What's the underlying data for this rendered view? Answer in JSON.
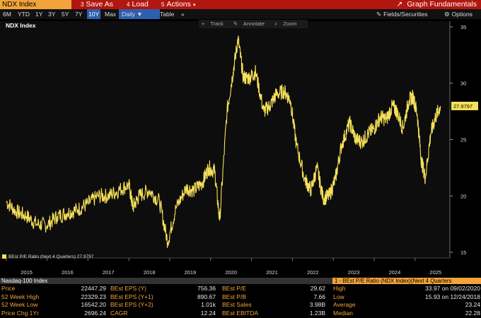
{
  "topbar": {
    "ticker": "NDX Index",
    "save_as": "Save As",
    "load": "Load",
    "actions": "Actions",
    "graph_fundamentals": "Graph Fundamentals"
  },
  "toolbar": {
    "ranges": [
      "6M",
      "YTD",
      "1Y",
      "3Y",
      "5Y",
      "7Y",
      "10Y",
      "Max"
    ],
    "active_range": "10Y",
    "frequency": "Daily",
    "table": "Table",
    "collapse": "«",
    "fields": "Fields/Securities",
    "options": "Options"
  },
  "chart_tools": {
    "track": "Track",
    "annotate": "Annotate",
    "zoom": "Zoom"
  },
  "chart_data": {
    "type": "line",
    "title": "NDX Index",
    "x_labels": [
      "2015",
      "2016",
      "2017",
      "2018",
      "2019",
      "2020",
      "2021",
      "2022",
      "2023",
      "2024",
      "2025"
    ],
    "y_ticks": [
      15,
      20,
      25,
      30,
      35
    ],
    "ylim": [
      14.5,
      35.5
    ],
    "series": [
      {
        "name": "BEst P/E Ratio (Next 4 Quarters)",
        "color": "#f6e05a",
        "last_label": "27.9797",
        "points": [
          [
            2015.0,
            19.5
          ],
          [
            2015.25,
            18.6
          ],
          [
            2015.5,
            18.2
          ],
          [
            2015.75,
            17.5
          ],
          [
            2016.0,
            17.4
          ],
          [
            2016.25,
            18.2
          ],
          [
            2016.5,
            18.5
          ],
          [
            2016.75,
            18.8
          ],
          [
            2017.0,
            19.3
          ],
          [
            2017.25,
            20.0
          ],
          [
            2017.5,
            20.0
          ],
          [
            2017.75,
            20.5
          ],
          [
            2018.0,
            21.0
          ],
          [
            2018.1,
            19.0
          ],
          [
            2018.25,
            20.0
          ],
          [
            2018.5,
            20.5
          ],
          [
            2018.75,
            19.5
          ],
          [
            2018.95,
            15.9
          ],
          [
            2019.15,
            18.9
          ],
          [
            2019.4,
            20.7
          ],
          [
            2019.6,
            20.5
          ],
          [
            2019.8,
            21.2
          ],
          [
            2019.95,
            22.5
          ],
          [
            2020.1,
            22.2
          ],
          [
            2020.22,
            17.8
          ],
          [
            2020.4,
            27.5
          ],
          [
            2020.55,
            31.0
          ],
          [
            2020.67,
            33.97
          ],
          [
            2020.8,
            30.5
          ],
          [
            2020.95,
            30.5
          ],
          [
            2021.1,
            31.0
          ],
          [
            2021.3,
            27.5
          ],
          [
            2021.45,
            28.0
          ],
          [
            2021.6,
            29.0
          ],
          [
            2021.8,
            29.3
          ],
          [
            2021.95,
            28.5
          ],
          [
            2022.1,
            24.5
          ],
          [
            2022.3,
            21.5
          ],
          [
            2022.45,
            20.5
          ],
          [
            2022.6,
            22.5
          ],
          [
            2022.75,
            19.8
          ],
          [
            2022.9,
            20.0
          ],
          [
            2023.05,
            21.5
          ],
          [
            2023.2,
            24.5
          ],
          [
            2023.4,
            26.5
          ],
          [
            2023.55,
            25.0
          ],
          [
            2023.7,
            24.8
          ],
          [
            2023.85,
            25.5
          ],
          [
            2024.0,
            26.0
          ],
          [
            2024.15,
            27.0
          ],
          [
            2024.3,
            26.8
          ],
          [
            2024.45,
            28.0
          ],
          [
            2024.55,
            27.5
          ],
          [
            2024.7,
            26.0
          ],
          [
            2024.85,
            28.5
          ],
          [
            2024.95,
            28.8
          ],
          [
            2025.05,
            27.3
          ],
          [
            2025.15,
            23.2
          ],
          [
            2025.25,
            21.6
          ],
          [
            2025.38,
            25.5
          ],
          [
            2025.5,
            27.0
          ],
          [
            2025.62,
            27.98
          ]
        ]
      }
    ]
  },
  "legend": {
    "label": "BEst P/E Ratio (Next 4 Quarters) 27.9797"
  },
  "footer": {
    "name": "Nasdaq-100 Index",
    "selected_series": "1 - BEst P/E Ratio (NDX Index)(Next 4 Quarters",
    "rows": [
      {
        "l1": "Price",
        "v1": "22447.29",
        "l2": "BEst EPS (Y)",
        "v2": "756.36",
        "l3": "BEst P/E",
        "v3": "29.62",
        "l4": "High",
        "v4": "33.97 on 09/02/2020"
      },
      {
        "l1": "52 Week High",
        "v1": "22329.23",
        "l2": "BEst EPS (Y+1)",
        "v2": "890.67",
        "l3": "BEst P/B",
        "v3": "7.66",
        "l4": "Low",
        "v4": "15.93 on 12/24/2018"
      },
      {
        "l1": "52 Week Low",
        "v1": "16542.20",
        "l2": "BEst EPS (Y+2)",
        "v2": "1.01k",
        "l3": "BEst Sales",
        "v3": "3.98B",
        "l4": "Average",
        "v4": "23.24"
      },
      {
        "l1": "Price Chg 1Yr",
        "v1": "2696.24",
        "l2": "CAGR",
        "v2": "12.24",
        "l3": "BEst EBITDA",
        "v3": "1.23B",
        "l4": "Median",
        "v4": "22.28"
      }
    ]
  }
}
